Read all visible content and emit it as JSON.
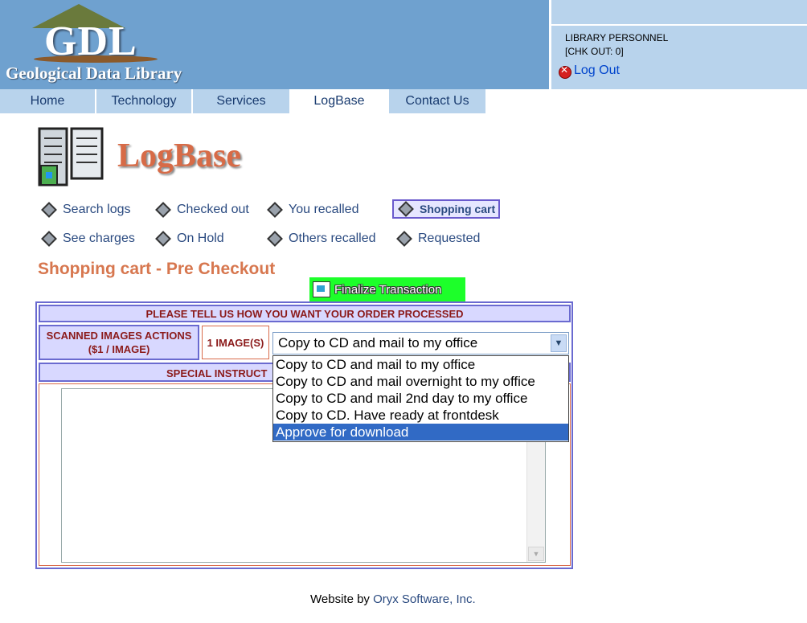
{
  "header": {
    "logo_text": "GDL",
    "logo_subtitle": "Geological Data Library",
    "user_role": "LIBRARY PERSONNEL",
    "checkout_status": "[CHK OUT: 0]",
    "logout_label": "Log Out"
  },
  "nav": {
    "tabs": [
      {
        "label": "Home"
      },
      {
        "label": "Technology"
      },
      {
        "label": "Services"
      },
      {
        "label": "LogBase"
      },
      {
        "label": "Contact Us"
      }
    ],
    "active": "LogBase"
  },
  "page": {
    "title": "LogBase",
    "section_title": "Shopping cart - Pre Checkout"
  },
  "menu": {
    "items": [
      {
        "label": "Search logs"
      },
      {
        "label": "Checked out"
      },
      {
        "label": "You recalled"
      },
      {
        "label": "Shopping cart"
      },
      {
        "label": "See charges"
      },
      {
        "label": "On Hold"
      },
      {
        "label": "Others recalled"
      },
      {
        "label": "Requested"
      }
    ],
    "selected": "Shopping cart"
  },
  "finalize_button": {
    "label": "Finalize Transaction"
  },
  "form": {
    "heading": "PLEASE TELL US HOW YOU WANT YOUR ORDER PROCESSED",
    "actions_label_line1": "SCANNED IMAGES ACTIONS",
    "actions_label_line2": "($1 / IMAGE)",
    "image_count": "1 IMAGE(S)",
    "select_value": "Copy to CD and mail to my office",
    "special_instructions_label": "SPECIAL INSTRUCT",
    "options": [
      "Copy to CD and mail to my office",
      "Copy to CD and mail overnight to my office",
      "Copy to CD and mail 2nd day to my office",
      "Copy to CD. Have ready at frontdesk",
      "Approve for download"
    ],
    "highlighted_option": "Approve for download"
  },
  "footer": {
    "prefix": "Website by ",
    "link": "Oryx Software, Inc."
  },
  "colors": {
    "header_blue": "#6fa1cf",
    "nav_blue": "#b8d3ec",
    "accent_orange": "#d7774f",
    "finalize_green": "#1dff2a",
    "option_highlight": "#316ac5"
  }
}
